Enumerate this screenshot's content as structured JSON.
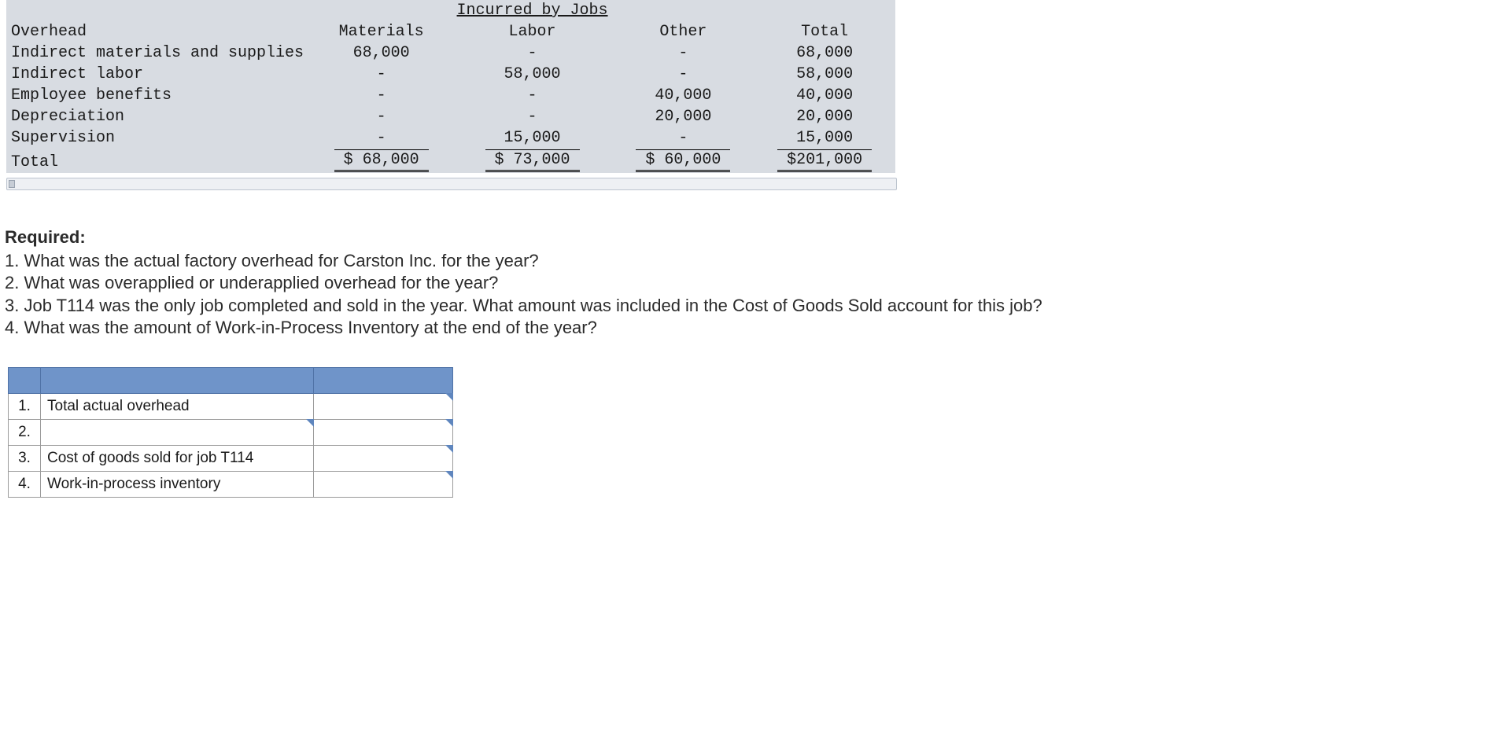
{
  "overhead_table": {
    "span_header": "Incurred by Jobs",
    "columns": {
      "desc": "Overhead",
      "materials": "Materials",
      "labor": "Labor",
      "other": "Other",
      "total": "Total"
    },
    "rows": [
      {
        "desc": "Indirect materials and supplies",
        "materials": "68,000",
        "labor": "-",
        "other": "-",
        "total": "68,000"
      },
      {
        "desc": "Indirect labor",
        "materials": "-",
        "labor": "58,000",
        "other": "-",
        "total": "58,000"
      },
      {
        "desc": "Employee benefits",
        "materials": "-",
        "labor": "-",
        "other": "40,000",
        "total": "40,000"
      },
      {
        "desc": "Depreciation",
        "materials": "-",
        "labor": "-",
        "other": "20,000",
        "total": "20,000"
      },
      {
        "desc": "Supervision",
        "materials": "-",
        "labor": "15,000",
        "other": "-",
        "total": "15,000"
      }
    ],
    "total_row": {
      "desc": "Total",
      "materials": "$ 68,000",
      "labor": "$ 73,000",
      "other": "$ 60,000",
      "total": "$201,000"
    }
  },
  "required": {
    "heading": "Required:",
    "items": [
      "1. What was the actual factory overhead for Carston Inc. for the year?",
      "2. What was overapplied or underapplied overhead for the year?",
      "3. Job T114 was the only job completed and sold in the year. What amount was included in the Cost of Goods Sold account for this job?",
      "4. What was the amount of Work-in-Process Inventory at the end of the year?"
    ]
  },
  "answer_table": {
    "rows": [
      {
        "num": "1.",
        "label": "Total actual overhead",
        "value": ""
      },
      {
        "num": "2.",
        "label": "",
        "value": ""
      },
      {
        "num": "3.",
        "label": "Cost of goods sold for job T114",
        "value": ""
      },
      {
        "num": "4.",
        "label": "Work-in-process inventory",
        "value": ""
      }
    ]
  },
  "chart_data": {
    "type": "table",
    "title": "Overhead — Incurred by Jobs",
    "columns": [
      "Overhead item",
      "Materials",
      "Labor",
      "Other",
      "Total"
    ],
    "rows": [
      [
        "Indirect materials and supplies",
        68000,
        null,
        null,
        68000
      ],
      [
        "Indirect labor",
        null,
        58000,
        null,
        58000
      ],
      [
        "Employee benefits",
        null,
        null,
        40000,
        40000
      ],
      [
        "Depreciation",
        null,
        null,
        20000,
        20000
      ],
      [
        "Supervision",
        null,
        15000,
        null,
        15000
      ]
    ],
    "totals": {
      "Materials": 68000,
      "Labor": 73000,
      "Other": 60000,
      "Total": 201000
    }
  }
}
